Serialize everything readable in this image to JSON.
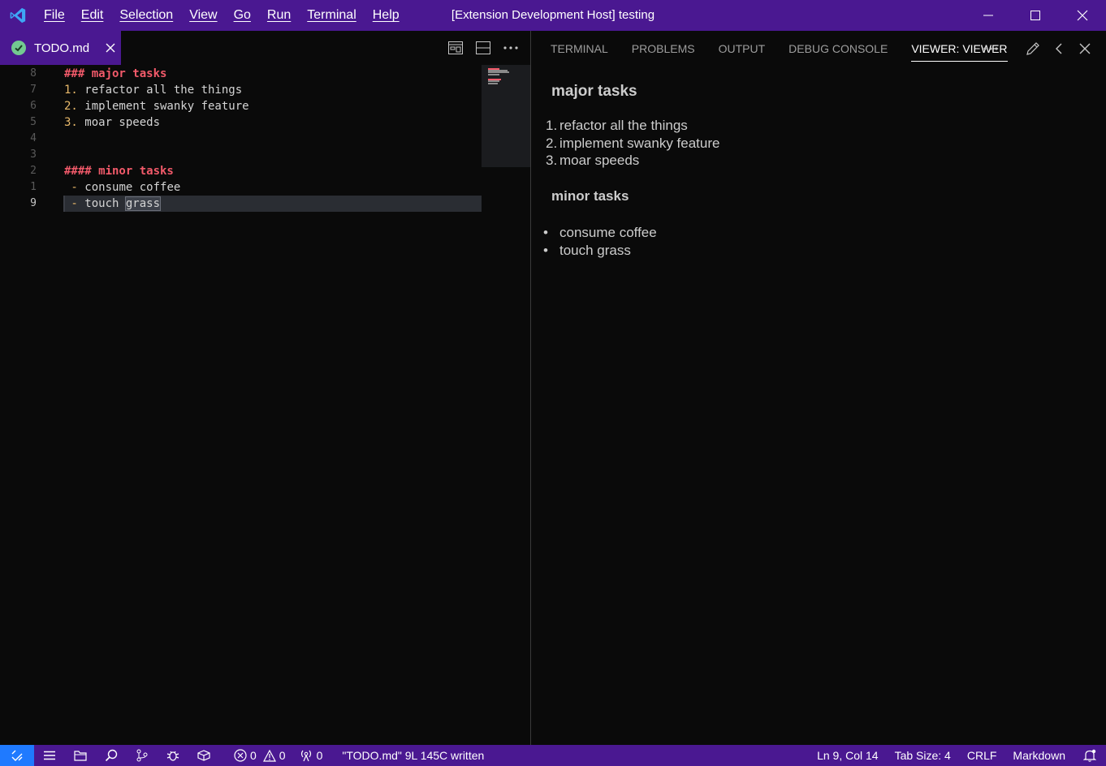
{
  "titlebar": {
    "menu": [
      "File",
      "Edit",
      "Selection",
      "View",
      "Go",
      "Run",
      "Terminal",
      "Help"
    ],
    "title": "[Extension Development Host] testing"
  },
  "editor": {
    "tab": {
      "label": "TODO.md",
      "status_icon": "check-circle-icon"
    },
    "lines": [
      {
        "num": "8",
        "parts": [
          {
            "t": "### major tasks",
            "c": "hdr"
          }
        ]
      },
      {
        "num": "7",
        "parts": [
          {
            "t": "1.",
            "c": "num"
          },
          {
            "t": " refactor all the things",
            "c": ""
          }
        ]
      },
      {
        "num": "6",
        "parts": [
          {
            "t": "2.",
            "c": "num"
          },
          {
            "t": " implement swanky feature",
            "c": ""
          }
        ]
      },
      {
        "num": "5",
        "parts": [
          {
            "t": "3.",
            "c": "num"
          },
          {
            "t": " moar speeds",
            "c": ""
          }
        ]
      },
      {
        "num": "4",
        "parts": []
      },
      {
        "num": "3",
        "parts": []
      },
      {
        "num": "2",
        "parts": [
          {
            "t": "#### minor tasks",
            "c": "hdr"
          }
        ]
      },
      {
        "num": "1",
        "parts": [
          {
            "t": " - ",
            "c": "num"
          },
          {
            "t": "consume coffee",
            "c": ""
          }
        ]
      },
      {
        "num": "9",
        "active": true,
        "parts": [
          {
            "t": " - ",
            "c": "num"
          },
          {
            "t": "touch ",
            "c": ""
          },
          {
            "t": "grass",
            "c": "sel"
          }
        ]
      }
    ]
  },
  "panel": {
    "tabs": [
      "TERMINAL",
      "PROBLEMS",
      "OUTPUT",
      "DEBUG CONSOLE",
      "VIEWER: VIEWER"
    ],
    "active_tab": "VIEWER: VIEWER",
    "viewer": {
      "h1": "major tasks",
      "ordered": [
        "refactor all the things",
        "implement swanky feature",
        "moar speeds"
      ],
      "h2": "minor tasks",
      "bullets": [
        "consume coffee",
        "touch grass"
      ]
    }
  },
  "statusbar": {
    "errors": "0",
    "warnings": "0",
    "ports": "0",
    "message": "\"TODO.md\" 9L 145C written",
    "position": "Ln 9, Col 14",
    "tab_size": "Tab Size: 4",
    "eol": "CRLF",
    "language": "Markdown"
  },
  "colors": {
    "accent": "#4a1891",
    "remote": "#1f7aff",
    "heading": "#f25a6a",
    "list_marker": "#e8b96a"
  }
}
